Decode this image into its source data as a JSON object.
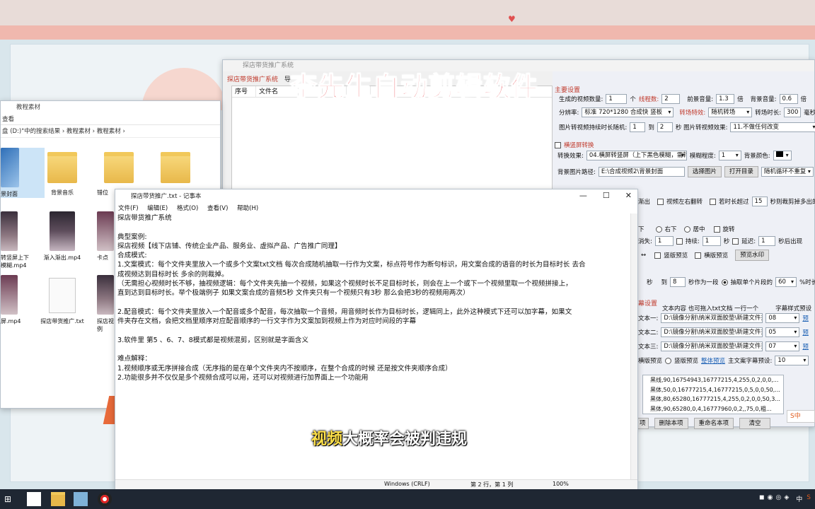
{
  "promo": {
    "title": "探店带货推广系统",
    "menu": [
      "探店带货推广系统",
      "导"
    ],
    "list_headers": [
      "序号",
      "文件名"
    ],
    "settings": {
      "section_main": "主要设置",
      "video_count_label": "生成的视频数量:",
      "video_count": "1",
      "unit_ge": "个",
      "threads_label": "线程数:",
      "threads": "2",
      "front_vol_label": "前景音量:",
      "front_vol": "1.3",
      "bei": "倍",
      "bg_vol_label": "背景音量:",
      "bg_vol": "0.6",
      "bei2": "倍",
      "res_label": "分辨率:",
      "res_value": "标准 720*1280 合成快 竖板",
      "trans_label": "转场特效:",
      "trans_value": "随机转场",
      "trans_dur_label": "转场时长:",
      "trans_dur": "300",
      "ms": "毫秒",
      "pic_time_label": "图片转视频持续时长随机:",
      "pic_from": "1",
      "to": "到",
      "pic_to": "2",
      "sec_pic_effect": "秒 图片转视频效果:",
      "pic_effect": "11.不做任何改变",
      "section_rotate": "横竖屏转换",
      "rotate_label": "转换效果:",
      "rotate_value": "04.横屏转竖屏（上下黑色模糊，需转两次）",
      "blur_label": "模糊程度:",
      "blur_value": "1",
      "bg_color_label": "背景颜色:",
      "bg_path_label": "背景图片路径:",
      "bg_path": "E:\\合成视频2\\背景封面",
      "choose_pic": "选择图片",
      "open_dir": "打开目录",
      "random_loop": "随机循环不重复",
      "mirror_label": "视频左右翻转",
      "exceed_label": "若时长超过",
      "exceed_value": "15",
      "exceed_tail": "秒则裁剪掉多出的",
      "out_label": "渐出",
      "pos_bottom_right": "右下",
      "pos_center": "居中",
      "rotate_chk": "旋转",
      "dur_label": "消失:",
      "dur_value": "1",
      "hold_label": "持续:",
      "hold_value": "1",
      "sec": "秒",
      "delay_label": "延迟:",
      "delay_value": "1",
      "appear_label": "秒后出现",
      "vertical_preview": "竖版预览",
      "horizontal_preview": "横版预览",
      "preview_watermark": "预览水印",
      "seg_sec": "秒",
      "seg_to": "到",
      "seg_value": "8",
      "seg_label": "秒作为一段",
      "pick_label": "抽取单个片段的",
      "pick_value": "60",
      "pct_label": "%时长",
      "caption_section": "幕设置",
      "text_content_label": "文本内容 也可拖入txt文档 一行一个",
      "caption_style_label": "字幕样式预设",
      "text_rows": [
        {
          "label": "文本一:",
          "path": "D:\\镜像分割\\纳米双面胶垫\\新建文件夹",
          "style": "08",
          "preview": "预"
        },
        {
          "label": "文本二:",
          "path": "D:\\镜像分割\\纳米双面胶垫\\新建文件夹",
          "style": "05",
          "preview": "预"
        },
        {
          "label": "文本三:",
          "path": "D:\\镜像分割\\纳米双面胶垫\\新建文件夹",
          "style": "07",
          "preview": "预"
        }
      ],
      "h_preview": "横版预览",
      "v_preview": "竖版预览",
      "overall_preview": "整体预览",
      "main_preset_label": "主文案字幕预设:",
      "main_preset": "10",
      "styles": [
        "黑线,90,16754943,16777215,4,255,0,2,0,0,...",
        "黑体,50,0,16777215,4,16777215,0,5,0,0,50,...",
        "黑体,80,65280,16777215,4,255,0,2,0,0,50,3...",
        "黑体,90,65280,0,4,16777960,0,2,,75,0,粗..."
      ],
      "delete_item": "删除本项",
      "rename_item": "重命名本项",
      "clear": "清空",
      "partial_btn": "项"
    }
  },
  "explorer": {
    "title": "教程素材",
    "ribbon": "查看",
    "path": "盘 (D:)\"中的搜索结果  ›  教程素材  ›  教程素材  ›",
    "files": [
      {
        "name": "景封面"
      },
      {
        "name": "背景音乐"
      },
      {
        "name": "错位"
      },
      {
        "name": ""
      },
      {
        "name": "转竖屏上下\n模糊.mp4"
      },
      {
        "name": "渐入渐出.mp4"
      },
      {
        "name": "卡点"
      },
      {
        "name": "屏.mp4"
      },
      {
        "name": "探店带货推广.txt"
      },
      {
        "name": "探店视\n例"
      }
    ]
  },
  "notepad": {
    "title": "探店带货推广.txt - 记事本",
    "menu": [
      "文件(F)",
      "编辑(E)",
      "格式(O)",
      "查看(V)",
      "帮助(H)"
    ],
    "lines": [
      "探店带货推广系统",
      "",
      "典型案例:",
      "探店视频【线下店铺、传统企业产品、服务业、虚拟产品、广告推广同理】",
      "合成模式:",
      "1.文案模式：每个文件夹里放入一个或多个文案txt文档 每次合成随机抽取一行作为文案，标点符号作为断句标识，用文案合成的语音的时长为目标时长 去合",
      "成视频达到目标时长 多余的则裁掉。",
      "（无需担心视频时长不够，抽视频逻辑：每个文件夹先抽一个视频，如果这个视频时长不足目标时长，则会在上一个或下一个视频里取一个视频拼接上，",
      "直到达到目标时长。举个极端例子 如果文案合成的音频5秒 文件夹只有一个视频只有3秒 那么会把3秒的视频用两次）",
      "",
      "2.配音模式：每个文件夹里放入一个配音或多个配音，每次抽取一个音频，用音频时长作为目标时长，逻辑同上，此外这种模式下还可以加字幕，如果文",
      "件夹存在文档，会把文档里顺序对应配音顺序的一行文字作为文案加到视频上作为对应时间段的字幕",
      "",
      "3.软件里 第5 、6、7、8模式都是视频混剪，区别就是字面含义",
      "",
      "难点解释：",
      "1.视频顺序或无序拼接合成（无序指的是在单个文件夹内不按顺序，在整个合成的时候 还是按文件夹顺序合成）",
      "2.功能很多并不仅仅是多个视频合成可以用，还可以对视频进行加界面上一个功能用"
    ],
    "status": {
      "encoding": "Windows (CRLF)",
      "position": "第 2 行，第 1 列",
      "zoom": "100%"
    },
    "controls": {
      "minimize": "—",
      "maximize": "☐",
      "close": "✕"
    }
  },
  "overlay": {
    "banner": "李先生自动剪辑软件",
    "subtitle_hl": "视频",
    "subtitle_rest": "大概率会被判违规",
    "ime": "S中"
  },
  "taskbar": {
    "clock": "中"
  }
}
